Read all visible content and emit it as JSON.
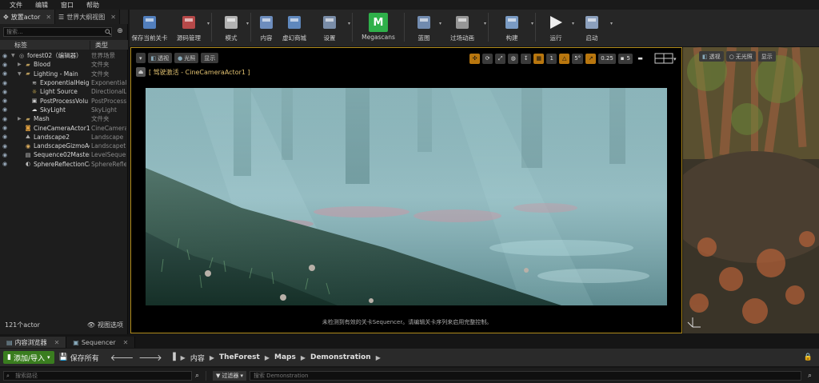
{
  "menu": [
    "文件",
    "编辑",
    "窗口",
    "帮助"
  ],
  "left_tabs": [
    {
      "label": "放置actor"
    },
    {
      "label": "世界大纲视图"
    }
  ],
  "outliner": {
    "search_placeholder": "搜索...",
    "col_label": "标签",
    "col_type": "类型",
    "rows": [
      {
        "name": "forest02（编辑器）",
        "type": "世界场景",
        "indent": 0,
        "arrow": "▼",
        "icon": "world"
      },
      {
        "name": "Blood",
        "type": "文件夹",
        "indent": 1,
        "arrow": "▶",
        "icon": "folder"
      },
      {
        "name": "Lighting - Main",
        "type": "文件夹",
        "indent": 1,
        "arrow": "▼",
        "icon": "folder"
      },
      {
        "name": "ExponentialHeigh",
        "type": "Exponential",
        "indent": 2,
        "arrow": "",
        "icon": "fog"
      },
      {
        "name": "Light Source",
        "type": "DirectionalL",
        "indent": 2,
        "arrow": "",
        "icon": "sun"
      },
      {
        "name": "PostProcessVolu",
        "type": "PostProcess",
        "indent": 2,
        "arrow": "",
        "icon": "volume"
      },
      {
        "name": "SkyLight",
        "type": "SkyLight",
        "indent": 2,
        "arrow": "",
        "icon": "sky"
      },
      {
        "name": "Mash",
        "type": "文件夹",
        "indent": 1,
        "arrow": "▶",
        "icon": "folder"
      },
      {
        "name": "CineCameraActor1",
        "type": "CineCamera",
        "indent": 1,
        "arrow": "",
        "icon": "camera"
      },
      {
        "name": "Landscape2",
        "type": "Landscape",
        "indent": 1,
        "arrow": "",
        "icon": "landscape"
      },
      {
        "name": "LandscapeGizmoAc",
        "type": "Landscapet",
        "indent": 1,
        "arrow": "",
        "icon": "gizmo"
      },
      {
        "name": "Sequence02Master",
        "type": "LevelSequer",
        "indent": 1,
        "arrow": "",
        "icon": "sequence"
      },
      {
        "name": "SphereReflectionCa",
        "type": "SphereRefle",
        "indent": 1,
        "arrow": "",
        "icon": "sphere"
      }
    ],
    "actor_count": "121个actor",
    "view_options": "视图选项"
  },
  "toolbar": [
    {
      "label": "保存当前关卡",
      "icon": "save-icon",
      "color": "#5a8fd8"
    },
    {
      "label": "源码管理",
      "icon": "source-control-icon",
      "color": "#d05050"
    },
    {
      "label": "模式",
      "icon": "modes-icon",
      "color": "#cccccc"
    },
    {
      "label": "内容",
      "icon": "content-icon",
      "color": "#7aa0d8"
    },
    {
      "label": "虚幻商城",
      "icon": "marketplace-icon",
      "color": "#6a9ad8"
    },
    {
      "label": "设置",
      "icon": "settings-icon",
      "color": "#8aa0c0"
    },
    {
      "label": "Megascans",
      "icon": "megascans-icon",
      "color": "#2fb04a"
    },
    {
      "label": "蓝图",
      "icon": "blueprint-icon",
      "color": "#7f9ec8"
    },
    {
      "label": "过场动画",
      "icon": "cinematics-icon",
      "color": "#aaaaaa"
    },
    {
      "label": "构建",
      "icon": "build-icon",
      "color": "#8ab0e0"
    },
    {
      "label": "运行",
      "icon": "play-icon",
      "color": "#dddddd"
    },
    {
      "label": "启动",
      "icon": "launch-icon",
      "color": "#9fb6d8"
    }
  ],
  "viewport": {
    "perspective": "透视",
    "lit": "光照",
    "show": "显示",
    "pilot_text": "[ 驾驶激活 - CineCameraActor1 ]",
    "snap_angle": "5°",
    "snap_scale": "0.25",
    "camera_speed": "5",
    "message": "未检测到有效的关卡Sequencer。请编辑关卡序列来启用完整控制。"
  },
  "right_viewport": {
    "perspective": "透视",
    "unlit": "无光照",
    "show": "显示"
  },
  "bottom_tabs": [
    {
      "label": "内容浏览器"
    },
    {
      "label": "Sequencer"
    }
  ],
  "content_browser": {
    "add_import": "添加/导入",
    "save_all": "保存所有",
    "breadcrumbs": [
      "内容",
      "TheForest",
      "Maps",
      "Demonstration"
    ],
    "path_search_placeholder": "搜索路径",
    "filter": "过滤器",
    "search_placeholder": "搜索 Demonstration"
  }
}
